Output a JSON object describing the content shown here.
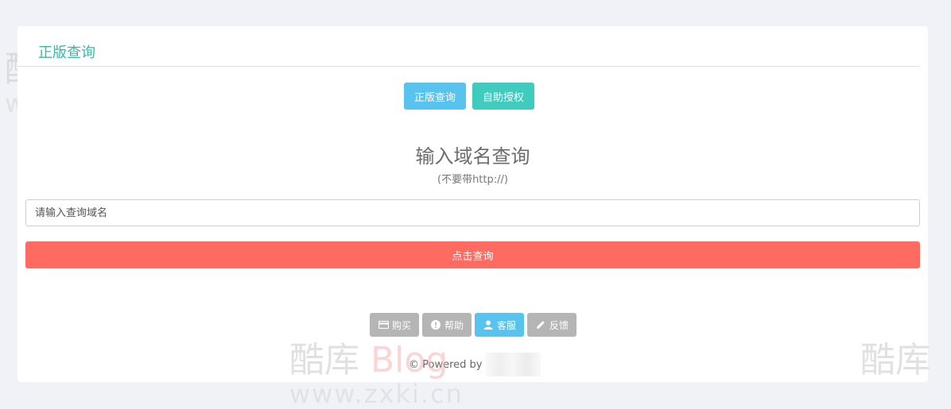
{
  "panel": {
    "title": "正版查询"
  },
  "tabs": [
    {
      "label": "正版查询",
      "color": "#57c3ee"
    },
    {
      "label": "自助授权",
      "color": "#3fcbbd"
    }
  ],
  "form": {
    "heading": "输入域名查询",
    "subheading": "(不要带http://)",
    "placeholder": "请输入查询域名",
    "value": "",
    "submit_label": "点击查询",
    "submit_color": "#ff6b61"
  },
  "footer": {
    "buttons": [
      {
        "label": "购买",
        "icon": "credit-card-icon"
      },
      {
        "label": "帮助",
        "icon": "exclamation-circle-icon"
      },
      {
        "label": "客服",
        "icon": "user-icon"
      },
      {
        "label": "反馈",
        "icon": "pencil-icon"
      }
    ],
    "powered_by": "© Powered by"
  },
  "watermark": {
    "brand_cn": "酷库",
    "brand_en": "Blog",
    "url": "www.zxki.cn"
  }
}
